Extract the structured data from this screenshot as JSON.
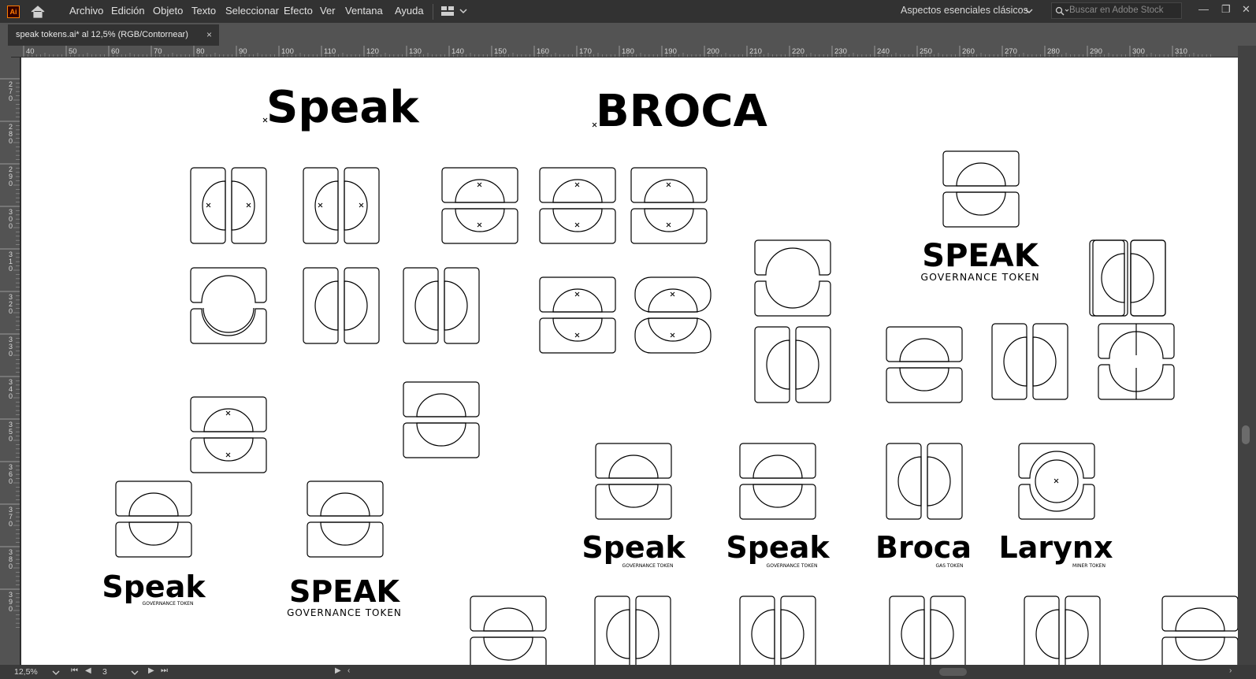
{
  "app": {
    "logo": "Ai",
    "home_icon": "home-icon"
  },
  "menu": [
    "Archivo",
    "Edición",
    "Objeto",
    "Texto",
    "Seleccionar",
    "Efecto",
    "Ver",
    "Ventana",
    "Ayuda"
  ],
  "workspace": "Aspectos esenciales clásicos",
  "search": {
    "placeholder": "Buscar en Adobe Stock"
  },
  "window": {
    "minimize": "—",
    "restore": "❐",
    "close": "✕"
  },
  "document": {
    "tab_title": "speak tokens.ai* al 12,5% (RGB/Contornear)",
    "close": "×"
  },
  "ruler": {
    "h_labels": [
      "40",
      "50",
      "60",
      "70",
      "80",
      "90",
      "100",
      "110",
      "120",
      "130",
      "140",
      "150",
      "160",
      "170",
      "180",
      "190",
      "200",
      "210",
      "220",
      "230",
      "240",
      "250",
      "260",
      "270",
      "280",
      "290",
      "300",
      "310"
    ],
    "v_labels": [
      "2\n7\n0",
      "2\n8\n0",
      "2\n9\n0",
      "3\n0\n0",
      "3\n1\n0",
      "3\n2\n0",
      "3\n3\n0",
      "3\n4\n0",
      "3\n5\n0",
      "3\n6\n0",
      "3\n7\n0",
      "3\n8\n0",
      "3\n9\n0"
    ]
  },
  "artboard": {
    "texts": {
      "speak_title": "Speak",
      "broca_title": "BROCA",
      "speak_caps": "SPEAK",
      "governance": "GOVERNANCE TOKEN",
      "speak1": "Speak",
      "speak2": "Speak",
      "broca2": "Broca",
      "larynx": "Larynx",
      "gov_small": "GOVERNANCE TOKEN",
      "gas_token": "GAS TOKEN",
      "miner_token": "MINER TOKEN",
      "speak_bottom_left": "Speak",
      "speak_caps_bottom": "SPEAK",
      "governance_bottom": "GOVERNANCE TOKEN"
    }
  },
  "status": {
    "zoom": "12,5%",
    "page": "3"
  }
}
